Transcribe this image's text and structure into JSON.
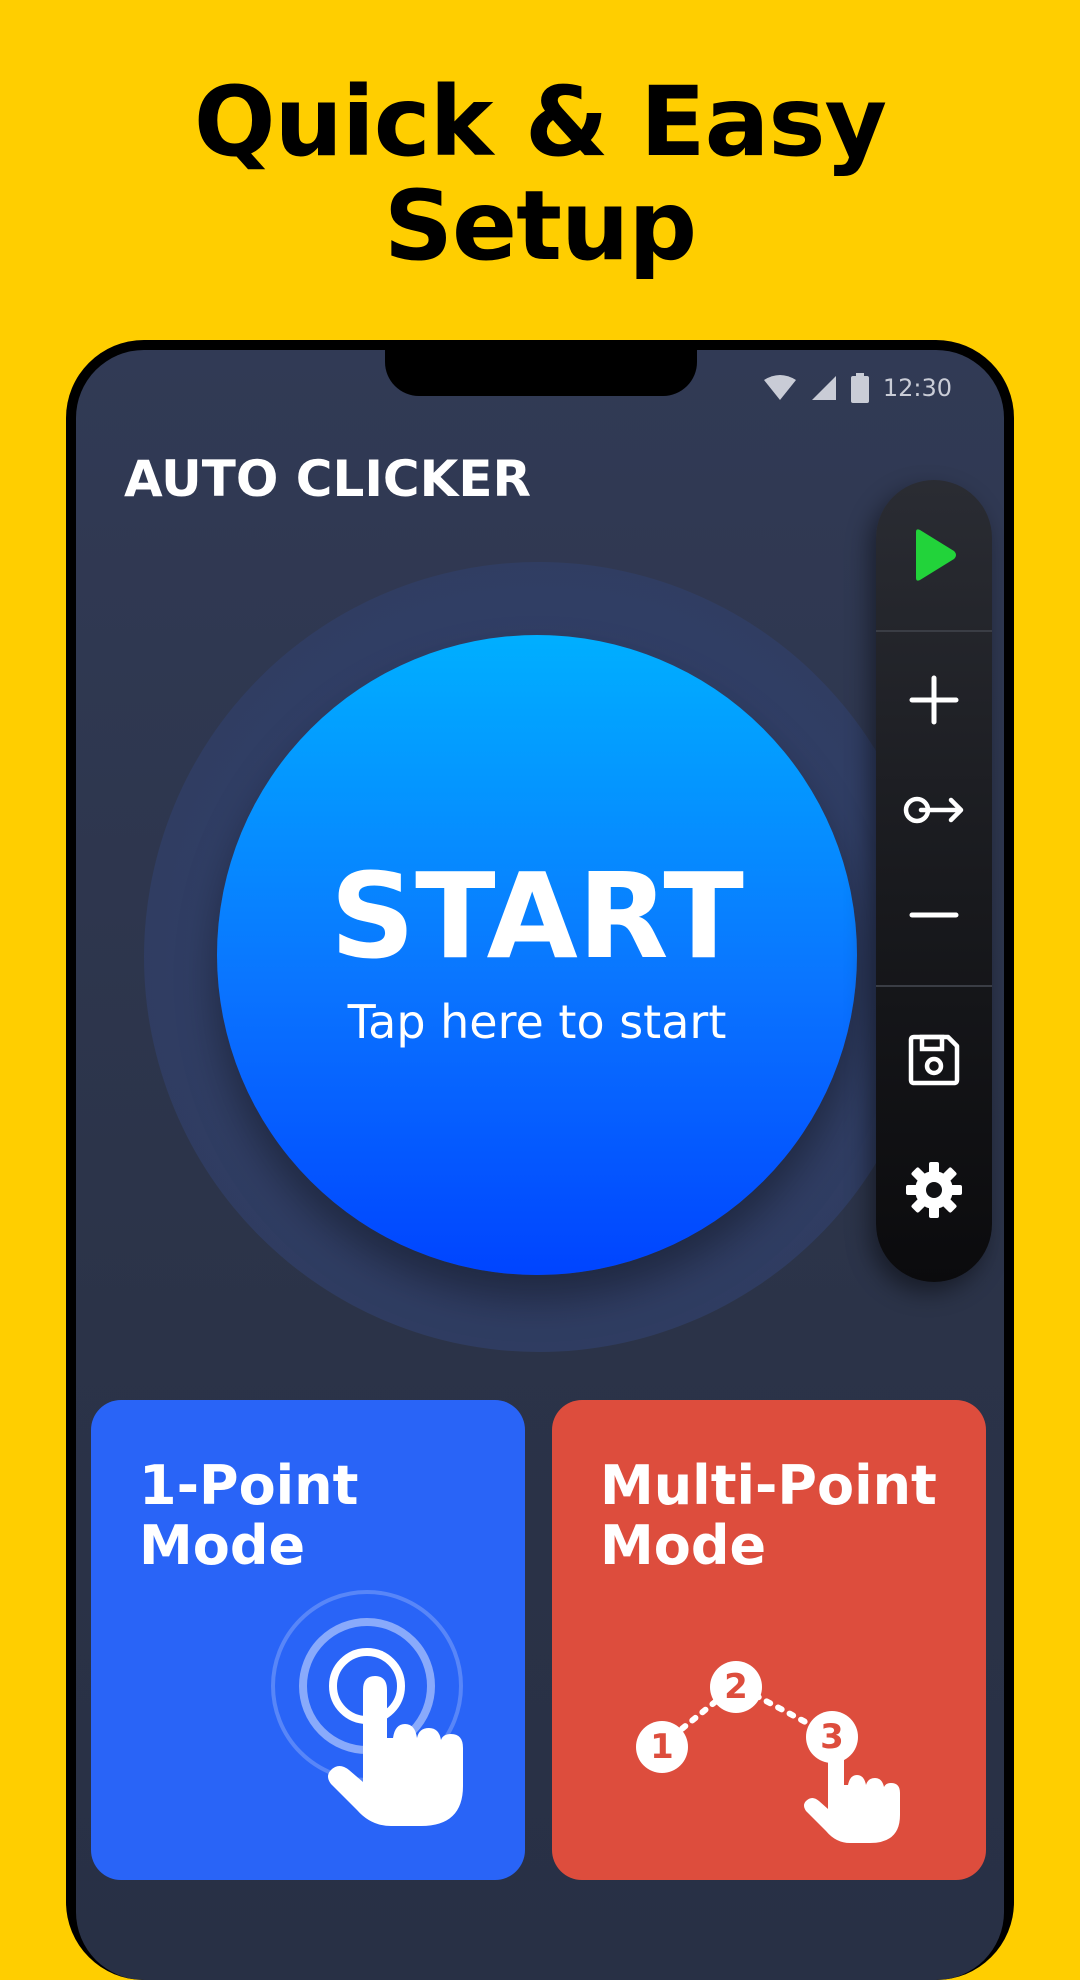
{
  "headline": {
    "line1": "Quick & Easy",
    "line2": "Setup"
  },
  "status_bar": {
    "time": "12:30",
    "icons": [
      "wifi-icon",
      "signal-icon",
      "battery-icon"
    ]
  },
  "app": {
    "title": "AUTO CLICKER"
  },
  "start_button": {
    "label": "START",
    "sublabel": "Tap here to start"
  },
  "toolbar": {
    "items": [
      "play-icon",
      "plus-icon",
      "swipe-icon",
      "minus-icon",
      "save-icon",
      "gear-icon"
    ]
  },
  "modes": [
    {
      "title_line1": "1-Point",
      "title_line2": "Mode",
      "color": "#2964F7"
    },
    {
      "title_line1": "Multi-Point",
      "title_line2": "Mode",
      "color": "#DD4D3D",
      "steps": [
        "1",
        "2",
        "3"
      ]
    }
  ],
  "colors": {
    "background": "#FFCE00",
    "play_accent": "#22D33A"
  }
}
